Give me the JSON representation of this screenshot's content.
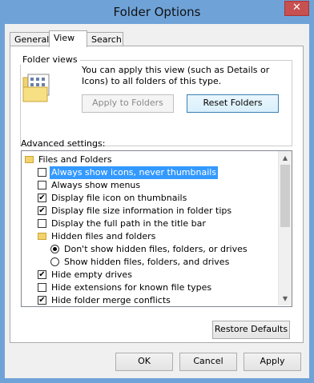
{
  "window": {
    "title": "Folder Options",
    "close_glyph": "✕"
  },
  "tabs": [
    {
      "label": "General"
    },
    {
      "label": "View"
    },
    {
      "label": "Search"
    }
  ],
  "folder_views": {
    "title": "Folder views",
    "description": "You can apply this view (such as Details or Icons) to all folders of this type.",
    "apply_label": "Apply to Folders",
    "reset_label": "Reset Folders"
  },
  "advanced": {
    "label": "Advanced settings:",
    "items": [
      {
        "kind": "folder",
        "label": "Files and Folders"
      },
      {
        "kind": "checkbox",
        "checked": false,
        "label": "Always show icons, never thumbnails",
        "selected": true
      },
      {
        "kind": "checkbox",
        "checked": false,
        "label": "Always show menus"
      },
      {
        "kind": "checkbox",
        "checked": true,
        "label": "Display file icon on thumbnails"
      },
      {
        "kind": "checkbox",
        "checked": true,
        "label": "Display file size information in folder tips"
      },
      {
        "kind": "checkbox",
        "checked": false,
        "label": "Display the full path in the title bar"
      },
      {
        "kind": "folder",
        "label": "Hidden files and folders"
      },
      {
        "kind": "radio",
        "checked": true,
        "label": "Don't show hidden files, folders, or drives"
      },
      {
        "kind": "radio",
        "checked": false,
        "label": "Show hidden files, folders, and drives"
      },
      {
        "kind": "checkbox",
        "checked": true,
        "label": "Hide empty drives"
      },
      {
        "kind": "checkbox",
        "checked": false,
        "label": "Hide extensions for known file types"
      },
      {
        "kind": "checkbox",
        "checked": true,
        "label": "Hide folder merge conflicts"
      }
    ]
  },
  "buttons": {
    "restore": "Restore Defaults",
    "ok": "OK",
    "cancel": "Cancel",
    "apply": "Apply"
  },
  "glyphs": {
    "check": "✔",
    "scroll_up": "▲",
    "scroll_down": "▼"
  }
}
